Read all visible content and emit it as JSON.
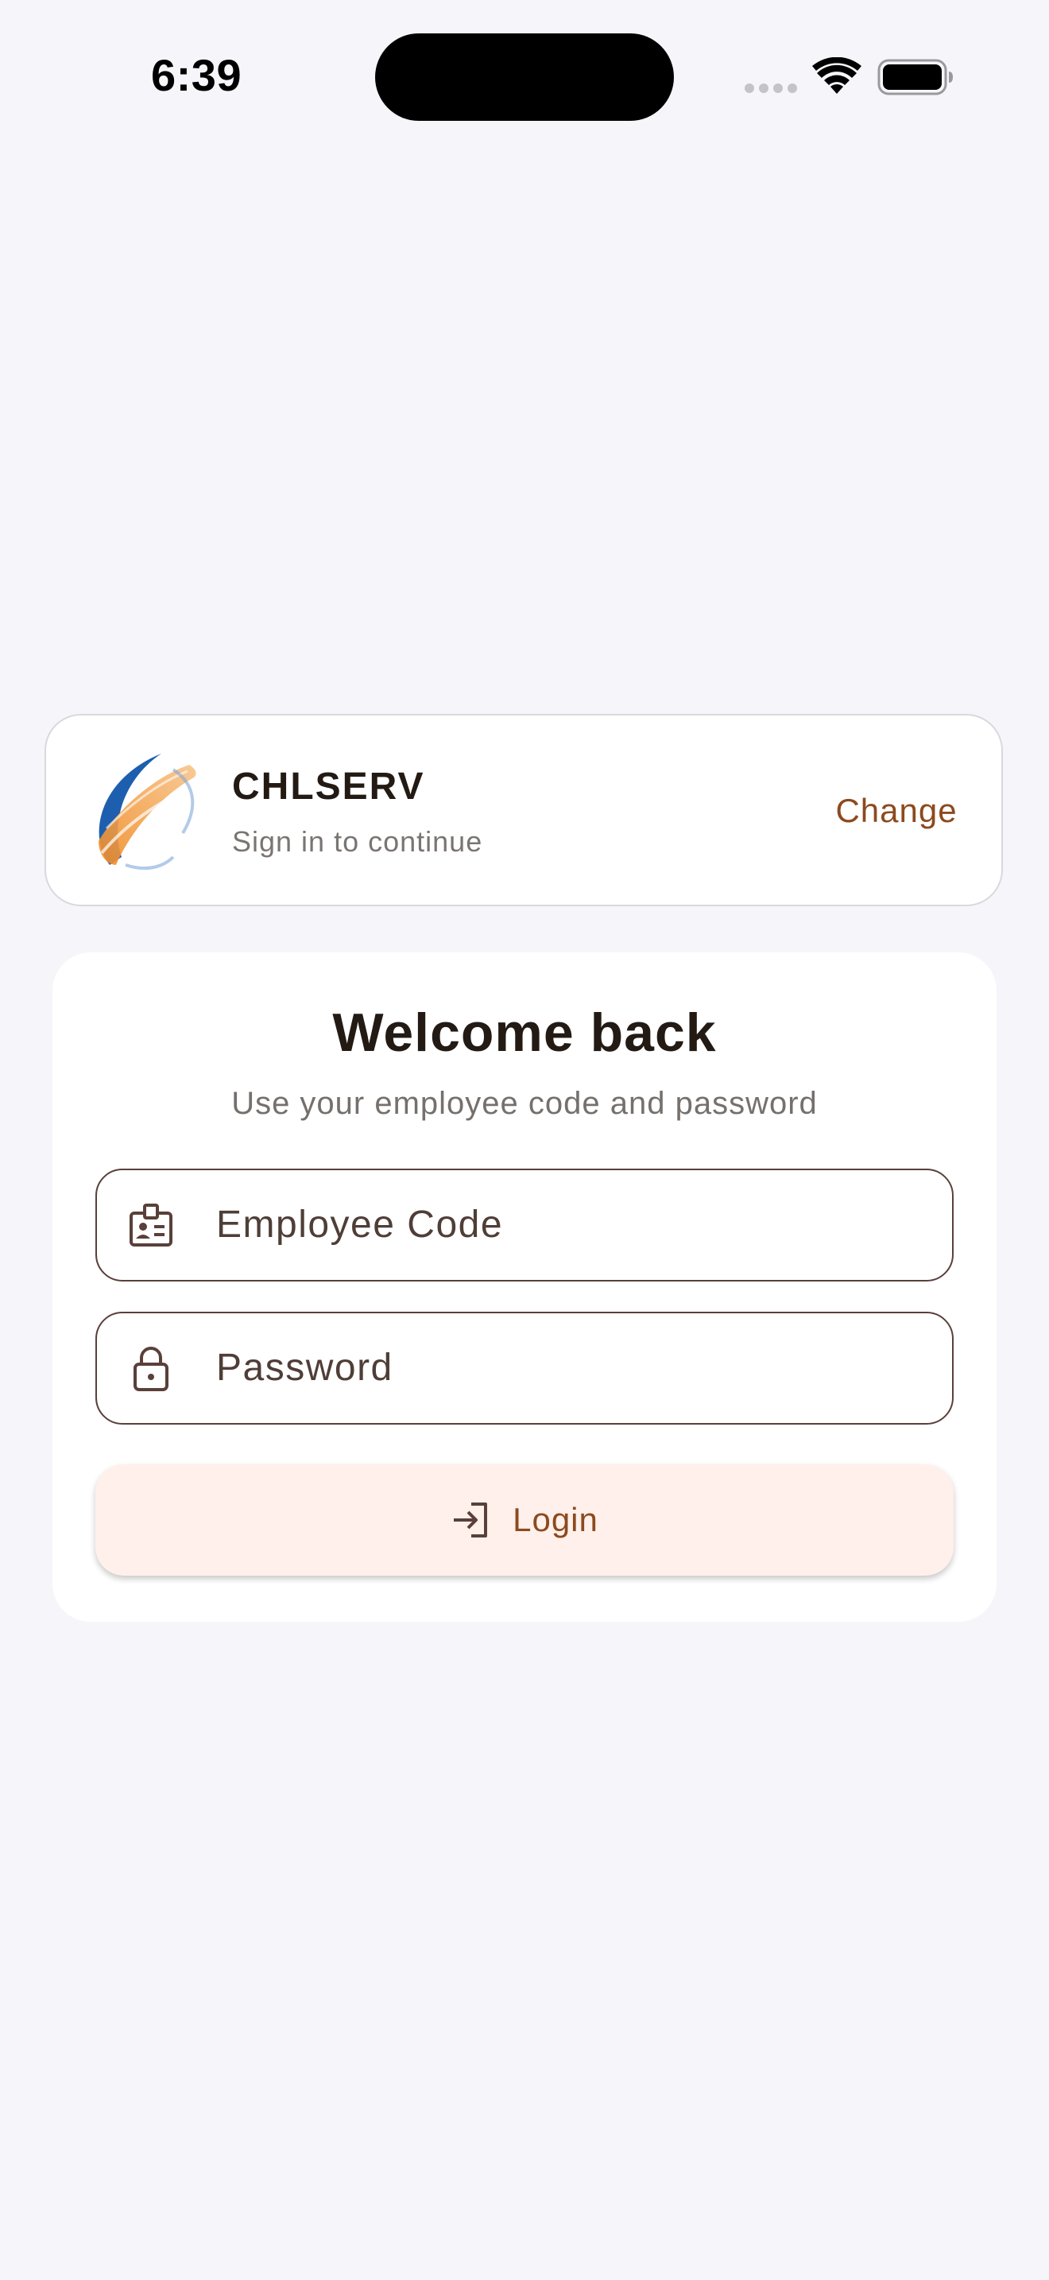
{
  "status_bar": {
    "time": "6:39"
  },
  "tenant": {
    "name": "CHLSERV",
    "subtitle": "Sign in to continue",
    "change_label": "Change",
    "logo_icon": "globe-swoosh-logo"
  },
  "login_card": {
    "title": "Welcome back",
    "subtitle": "Use your employee code and password",
    "employee_field": {
      "placeholder": "Employee Code",
      "value": "",
      "icon": "id-badge-icon"
    },
    "password_field": {
      "placeholder": "Password",
      "value": "",
      "icon": "lock-icon"
    },
    "login_button": {
      "label": "Login",
      "icon": "login-arrow-icon"
    }
  },
  "colors": {
    "background": "#f5f5fa",
    "accent": "#8c4a1e",
    "button_background": "#fff0eb",
    "field_border": "#5a403a",
    "heading_text": "#231a14"
  }
}
